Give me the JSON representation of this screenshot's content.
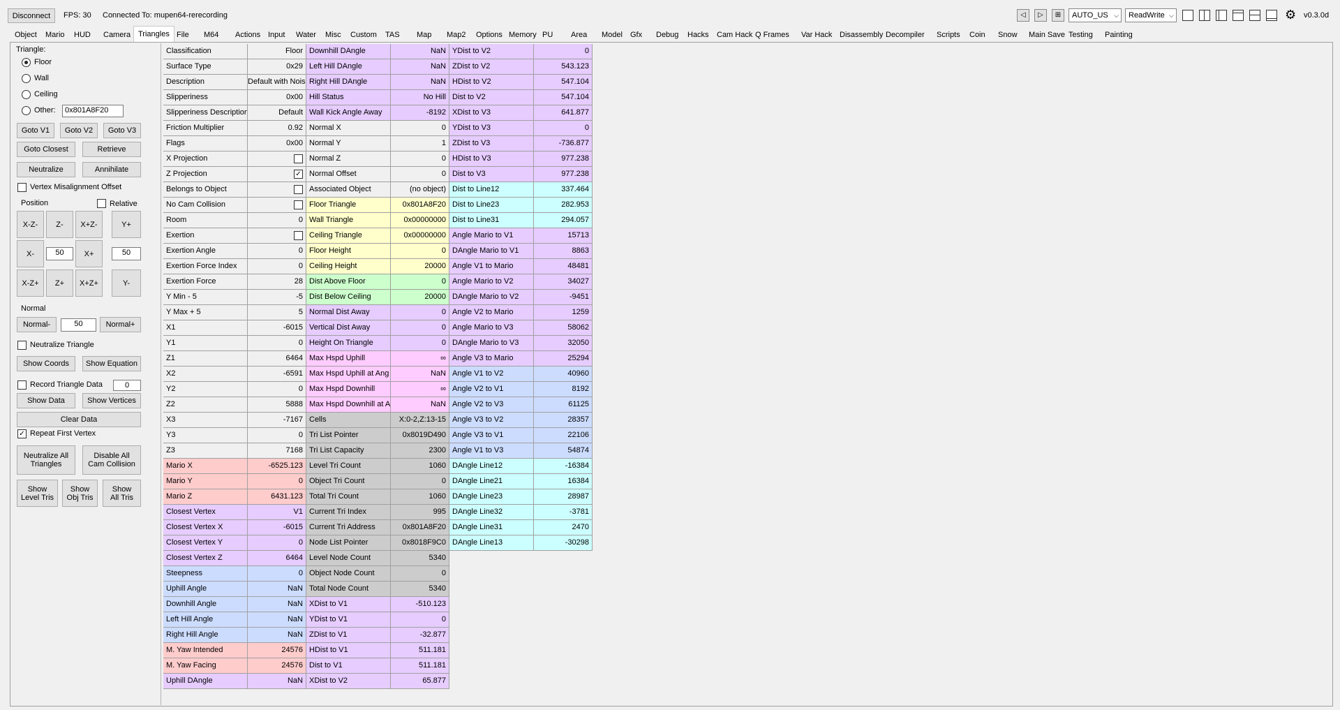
{
  "toolbar": {
    "disconnect": "Disconnect",
    "fps": "FPS: 30",
    "connected": "Connected To: mupen64-rerecording",
    "region": "AUTO_US",
    "access": "ReadWrite",
    "version": "v0.3.0d",
    "icons": [
      "step-back-icon",
      "step-forward-icon",
      "add-frame-icon",
      "layout-single-icon",
      "layout-double-vertical-icon",
      "layout-left-panel-icon",
      "layout-top-panel-icon",
      "layout-split-horizontal-icon",
      "layout-minimal-icon",
      "gear-icon"
    ]
  },
  "tabs": [
    "Object",
    "Mario",
    "HUD",
    "Camera",
    "Triangles",
    "File",
    "M64",
    "Actions",
    "Input",
    "Water",
    "Misc",
    "Custom",
    "TAS",
    "Map",
    "Map2",
    "Options",
    "Memory",
    "PU",
    "Area",
    "Model",
    "Gfx",
    "Debug",
    "Hacks",
    "Cam Hack",
    "Q Frames",
    "Var Hack",
    "Disassembly",
    "Decompiler",
    "Scripts",
    "Coin",
    "Snow",
    "Main Save",
    "Testing",
    "Painting"
  ],
  "active_tab": "Triangles",
  "left": {
    "triangle_label": "Triangle:",
    "radios": [
      "Floor",
      "Wall",
      "Ceiling",
      "Other:"
    ],
    "radio_selected": "Floor",
    "other_value": "0x801A8F20",
    "goto_v1": "Goto V1",
    "goto_v2": "Goto V2",
    "goto_v3": "Goto V3",
    "goto_closest": "Goto Closest",
    "retrieve": "Retrieve",
    "neutralize": "Neutralize",
    "annihilate": "Annihilate",
    "vertex_misalignment": "Vertex Misalignment Offset",
    "position_label": "Position",
    "relative_label": "Relative",
    "pad": [
      "X-Z-",
      "Z-",
      "X+Z-",
      "X-",
      "X+",
      "X-Z+",
      "Z+",
      "X+Z+"
    ],
    "y_plus": "Y+",
    "y_minus": "Y-",
    "xz_step": "50",
    "y_step": "50",
    "normal_label": "Normal",
    "normal_minus": "Normal-",
    "normal_plus": "Normal+",
    "normal_step": "50",
    "neutralize_triangle": "Neutralize Triangle",
    "show_coords": "Show Coords",
    "show_equation": "Show Equation",
    "record_triangle_data": "Record Triangle Data",
    "record_count": "0",
    "show_data": "Show Data",
    "show_vertices": "Show Vertices",
    "clear_data": "Clear Data",
    "repeat_first_vertex": "Repeat First Vertex",
    "neutralize_all": "Neutralize All\nTriangles",
    "disable_cam_collision": "Disable All\nCam Collision",
    "show_level_tris": "Show\nLevel Tris",
    "show_obj_tris": "Show\nObj Tris",
    "show_all_tris": "Show\nAll Tris"
  },
  "columns": [
    [
      {
        "n": "Classification",
        "v": "Floor",
        "c": "white"
      },
      {
        "n": "Surface Type",
        "v": "0x29",
        "c": "white"
      },
      {
        "n": "Description",
        "v": "Default with Nois",
        "c": "white"
      },
      {
        "n": "Slipperiness",
        "v": "0x00",
        "c": "white"
      },
      {
        "n": "Slipperiness Description",
        "v": "Default",
        "c": "white"
      },
      {
        "n": "Friction Multiplier",
        "v": "0.92",
        "c": "white"
      },
      {
        "n": "Flags",
        "v": "0x00",
        "c": "white"
      },
      {
        "n": "X Projection",
        "v": "",
        "cb": false,
        "c": "white"
      },
      {
        "n": "Z Projection",
        "v": "",
        "cb": true,
        "c": "white"
      },
      {
        "n": "Belongs to Object",
        "v": "",
        "cb": false,
        "c": "white"
      },
      {
        "n": "No Cam Collision",
        "v": "",
        "cb": false,
        "c": "white"
      },
      {
        "n": "Room",
        "v": "0",
        "c": "white"
      },
      {
        "n": "Exertion",
        "v": "",
        "cb": false,
        "c": "white"
      },
      {
        "n": "Exertion Angle",
        "v": "0",
        "c": "white"
      },
      {
        "n": "Exertion Force Index",
        "v": "0",
        "c": "white"
      },
      {
        "n": "Exertion Force",
        "v": "28",
        "c": "white"
      },
      {
        "n": "Y Min - 5",
        "v": "-5",
        "c": "white"
      },
      {
        "n": "Y Max + 5",
        "v": "5",
        "c": "white"
      },
      {
        "n": "X1",
        "v": "-6015",
        "c": "white"
      },
      {
        "n": "Y1",
        "v": "0",
        "c": "white"
      },
      {
        "n": "Z1",
        "v": "6464",
        "c": "white"
      },
      {
        "n": "X2",
        "v": "-6591",
        "c": "white"
      },
      {
        "n": "Y2",
        "v": "0",
        "c": "white"
      },
      {
        "n": "Z2",
        "v": "5888",
        "c": "white"
      },
      {
        "n": "X3",
        "v": "-7167",
        "c": "white"
      },
      {
        "n": "Y3",
        "v": "0",
        "c": "white"
      },
      {
        "n": "Z3",
        "v": "7168",
        "c": "white"
      },
      {
        "n": "Mario X",
        "v": "-6525.123",
        "c": "red"
      },
      {
        "n": "Mario Y",
        "v": "0",
        "c": "red"
      },
      {
        "n": "Mario Z",
        "v": "6431.123",
        "c": "red"
      },
      {
        "n": "Closest Vertex",
        "v": "V1",
        "c": "purple"
      },
      {
        "n": "Closest Vertex X",
        "v": "-6015",
        "c": "purple"
      },
      {
        "n": "Closest Vertex Y",
        "v": "0",
        "c": "purple"
      },
      {
        "n": "Closest Vertex Z",
        "v": "6464",
        "c": "purple"
      },
      {
        "n": "Steepness",
        "v": "0",
        "c": "blue"
      },
      {
        "n": "Uphill Angle",
        "v": "NaN",
        "c": "blue"
      },
      {
        "n": "Downhill Angle",
        "v": "NaN",
        "c": "blue"
      },
      {
        "n": "Left Hill Angle",
        "v": "NaN",
        "c": "blue"
      },
      {
        "n": "Right Hill Angle",
        "v": "NaN",
        "c": "blue"
      },
      {
        "n": "M. Yaw Intended",
        "v": "24576",
        "c": "red"
      },
      {
        "n": "M. Yaw Facing",
        "v": "24576",
        "c": "red"
      },
      {
        "n": "Uphill DAngle",
        "v": "NaN",
        "c": "purple"
      }
    ],
    [
      {
        "n": "Downhill DAngle",
        "v": "NaN",
        "c": "purple"
      },
      {
        "n": "Left Hill DAngle",
        "v": "NaN",
        "c": "purple"
      },
      {
        "n": "Right Hill DAngle",
        "v": "NaN",
        "c": "purple"
      },
      {
        "n": "Hill Status",
        "v": "No Hill",
        "c": "purple"
      },
      {
        "n": "Wall Kick Angle Away",
        "v": "-8192",
        "c": "purple"
      },
      {
        "n": "Normal X",
        "v": "0",
        "c": "white"
      },
      {
        "n": "Normal Y",
        "v": "1",
        "c": "white"
      },
      {
        "n": "Normal Z",
        "v": "0",
        "c": "white"
      },
      {
        "n": "Normal Offset",
        "v": "0",
        "c": "white"
      },
      {
        "n": "Associated Object",
        "v": "(no object)",
        "c": "white"
      },
      {
        "n": "Floor Triangle",
        "v": "0x801A8F20",
        "c": "yellow"
      },
      {
        "n": "Wall Triangle",
        "v": "0x00000000",
        "c": "yellow"
      },
      {
        "n": "Ceiling Triangle",
        "v": "0x00000000",
        "c": "yellow"
      },
      {
        "n": "Floor Height",
        "v": "0",
        "c": "yellow"
      },
      {
        "n": "Ceiling Height",
        "v": "20000",
        "c": "yellow"
      },
      {
        "n": "Dist Above Floor",
        "v": "0",
        "c": "green"
      },
      {
        "n": "Dist Below Ceiling",
        "v": "20000",
        "c": "green"
      },
      {
        "n": "Normal Dist Away",
        "v": "0",
        "c": "purple"
      },
      {
        "n": "Vertical Dist Away",
        "v": "0",
        "c": "purple"
      },
      {
        "n": "Height On Triangle",
        "v": "0",
        "c": "purple"
      },
      {
        "n": "Max Hspd Uphill",
        "v": "∞",
        "c": "pink"
      },
      {
        "n": "Max Hspd Uphill at Ang",
        "v": "NaN",
        "c": "pink"
      },
      {
        "n": "Max Hspd Downhill",
        "v": "∞",
        "c": "pink"
      },
      {
        "n": "Max Hspd Downhill at Ar",
        "v": "NaN",
        "c": "pink"
      },
      {
        "n": "Cells",
        "v": "X:0-2,Z:13-15",
        "c": "gray"
      },
      {
        "n": "Tri List Pointer",
        "v": "0x8019D490",
        "c": "gray"
      },
      {
        "n": "Tri List Capacity",
        "v": "2300",
        "c": "gray"
      },
      {
        "n": "Level Tri Count",
        "v": "1060",
        "c": "gray"
      },
      {
        "n": "Object Tri Count",
        "v": "0",
        "c": "gray"
      },
      {
        "n": "Total Tri Count",
        "v": "1060",
        "c": "gray"
      },
      {
        "n": "Current Tri Index",
        "v": "995",
        "c": "gray"
      },
      {
        "n": "Current Tri Address",
        "v": "0x801A8F20",
        "c": "gray"
      },
      {
        "n": "Node List Pointer",
        "v": "0x8018F9C0",
        "c": "gray"
      },
      {
        "n": "Level Node Count",
        "v": "5340",
        "c": "gray"
      },
      {
        "n": "Object Node Count",
        "v": "0",
        "c": "gray"
      },
      {
        "n": "Total Node Count",
        "v": "5340",
        "c": "gray"
      },
      {
        "n": "XDist to V1",
        "v": "-510.123",
        "c": "purple"
      },
      {
        "n": "YDist to V1",
        "v": "0",
        "c": "purple"
      },
      {
        "n": "ZDist to V1",
        "v": "-32.877",
        "c": "purple"
      },
      {
        "n": "HDist to V1",
        "v": "511.181",
        "c": "purple"
      },
      {
        "n": "Dist to V1",
        "v": "511.181",
        "c": "purple"
      },
      {
        "n": "XDist to V2",
        "v": "65.877",
        "c": "purple"
      }
    ],
    [
      {
        "n": "YDist to V2",
        "v": "0",
        "c": "purple"
      },
      {
        "n": "ZDist to V2",
        "v": "543.123",
        "c": "purple"
      },
      {
        "n": "HDist to V2",
        "v": "547.104",
        "c": "purple"
      },
      {
        "n": "Dist to V2",
        "v": "547.104",
        "c": "purple"
      },
      {
        "n": "XDist to V3",
        "v": "641.877",
        "c": "purple"
      },
      {
        "n": "YDist to V3",
        "v": "0",
        "c": "purple"
      },
      {
        "n": "ZDist to V3",
        "v": "-736.877",
        "c": "purple"
      },
      {
        "n": "HDist to V3",
        "v": "977.238",
        "c": "purple"
      },
      {
        "n": "Dist to V3",
        "v": "977.238",
        "c": "purple"
      },
      {
        "n": "Dist to Line12",
        "v": "337.464",
        "c": "cyan"
      },
      {
        "n": "Dist to Line23",
        "v": "282.953",
        "c": "cyan"
      },
      {
        "n": "Dist to Line31",
        "v": "294.057",
        "c": "cyan"
      },
      {
        "n": "Angle Mario to V1",
        "v": "15713",
        "c": "purple"
      },
      {
        "n": "DAngle Mario to V1",
        "v": "8863",
        "c": "purple"
      },
      {
        "n": "Angle V1 to Mario",
        "v": "48481",
        "c": "purple"
      },
      {
        "n": "Angle Mario to V2",
        "v": "34027",
        "c": "purple"
      },
      {
        "n": "DAngle Mario to V2",
        "v": "-9451",
        "c": "purple"
      },
      {
        "n": "Angle V2 to Mario",
        "v": "1259",
        "c": "purple"
      },
      {
        "n": "Angle Mario to V3",
        "v": "58062",
        "c": "purple"
      },
      {
        "n": "DAngle Mario to V3",
        "v": "32050",
        "c": "purple"
      },
      {
        "n": "Angle V3 to Mario",
        "v": "25294",
        "c": "purple"
      },
      {
        "n": "Angle V1 to V2",
        "v": "40960",
        "c": "blue"
      },
      {
        "n": "Angle V2 to V1",
        "v": "8192",
        "c": "blue"
      },
      {
        "n": "Angle V2 to V3",
        "v": "61125",
        "c": "blue"
      },
      {
        "n": "Angle V3 to V2",
        "v": "28357",
        "c": "blue"
      },
      {
        "n": "Angle V3 to V1",
        "v": "22106",
        "c": "blue"
      },
      {
        "n": "Angle V1 to V3",
        "v": "54874",
        "c": "blue"
      },
      {
        "n": "DAngle Line12",
        "v": "-16384",
        "c": "cyan"
      },
      {
        "n": "DAngle Line21",
        "v": "16384",
        "c": "cyan"
      },
      {
        "n": "DAngle Line23",
        "v": "28987",
        "c": "cyan"
      },
      {
        "n": "DAngle Line32",
        "v": "-3781",
        "c": "cyan"
      },
      {
        "n": "DAngle Line31",
        "v": "2470",
        "c": "cyan"
      },
      {
        "n": "DAngle Line13",
        "v": "-30298",
        "c": "cyan"
      }
    ]
  ],
  "colors": {
    "white": "#f0f0f0",
    "red": "#ffcccc",
    "purple": "#e6ccff",
    "blue": "#ccdcff",
    "yellow": "#ffffcc",
    "green": "#ccffcc",
    "pink": "#ffccff",
    "gray": "#cccccc",
    "cyan": "#ccffff"
  }
}
